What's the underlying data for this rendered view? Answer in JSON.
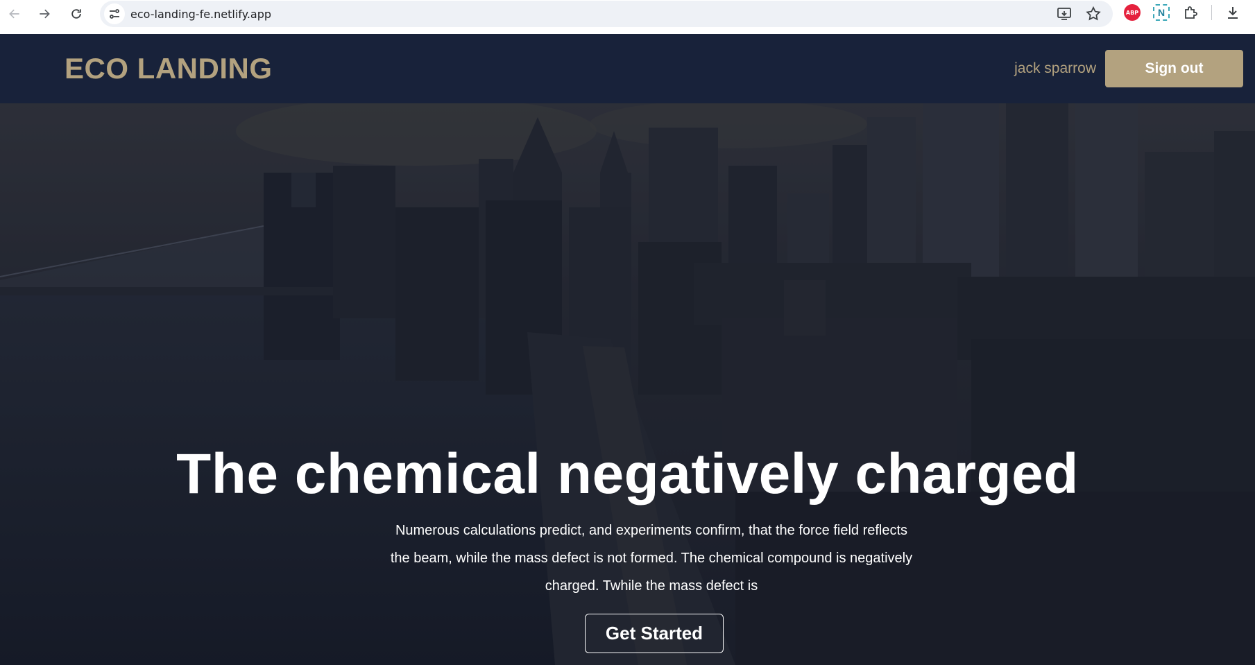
{
  "browser": {
    "url": "eco-landing-fe.netlify.app",
    "extensions": {
      "abp_label": "ABP",
      "n_label": "N"
    }
  },
  "header": {
    "brand": "ECO LANDING",
    "username": "jack sparrow",
    "signout_label": "Sign out"
  },
  "hero": {
    "title": "The chemical negatively charged",
    "description": "Numerous calculations predict, and experiments confirm, that the force field reflects the beam, while the mass defect is not formed. The chemical compound is negatively charged. Twhile the mass defect is",
    "cta_label": "Get Started"
  },
  "colors": {
    "accent": "#b3a27f",
    "header_bg": "#18223a",
    "hero_text": "#ffffff"
  }
}
